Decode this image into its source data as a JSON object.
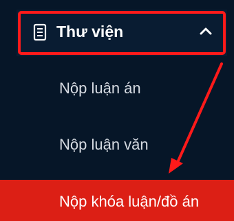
{
  "sidebar": {
    "section": {
      "icon": "book-icon",
      "title": "Thư viện",
      "expanded_icon": "chevron-up-icon"
    },
    "items": [
      {
        "label": "Nộp luận án"
      },
      {
        "label": "Nộp luận văn"
      },
      {
        "label": "Nộp khóa luận/đồ án",
        "active": true
      }
    ]
  },
  "colors": {
    "sidebar_bg": "#061628",
    "active_item_bg": "#dc1f15",
    "highlight_border": "#ff1a1a",
    "annotation_arrow": "#ff1a1a",
    "text": "#ffffff",
    "muted_text": "#d6dbe2"
  }
}
